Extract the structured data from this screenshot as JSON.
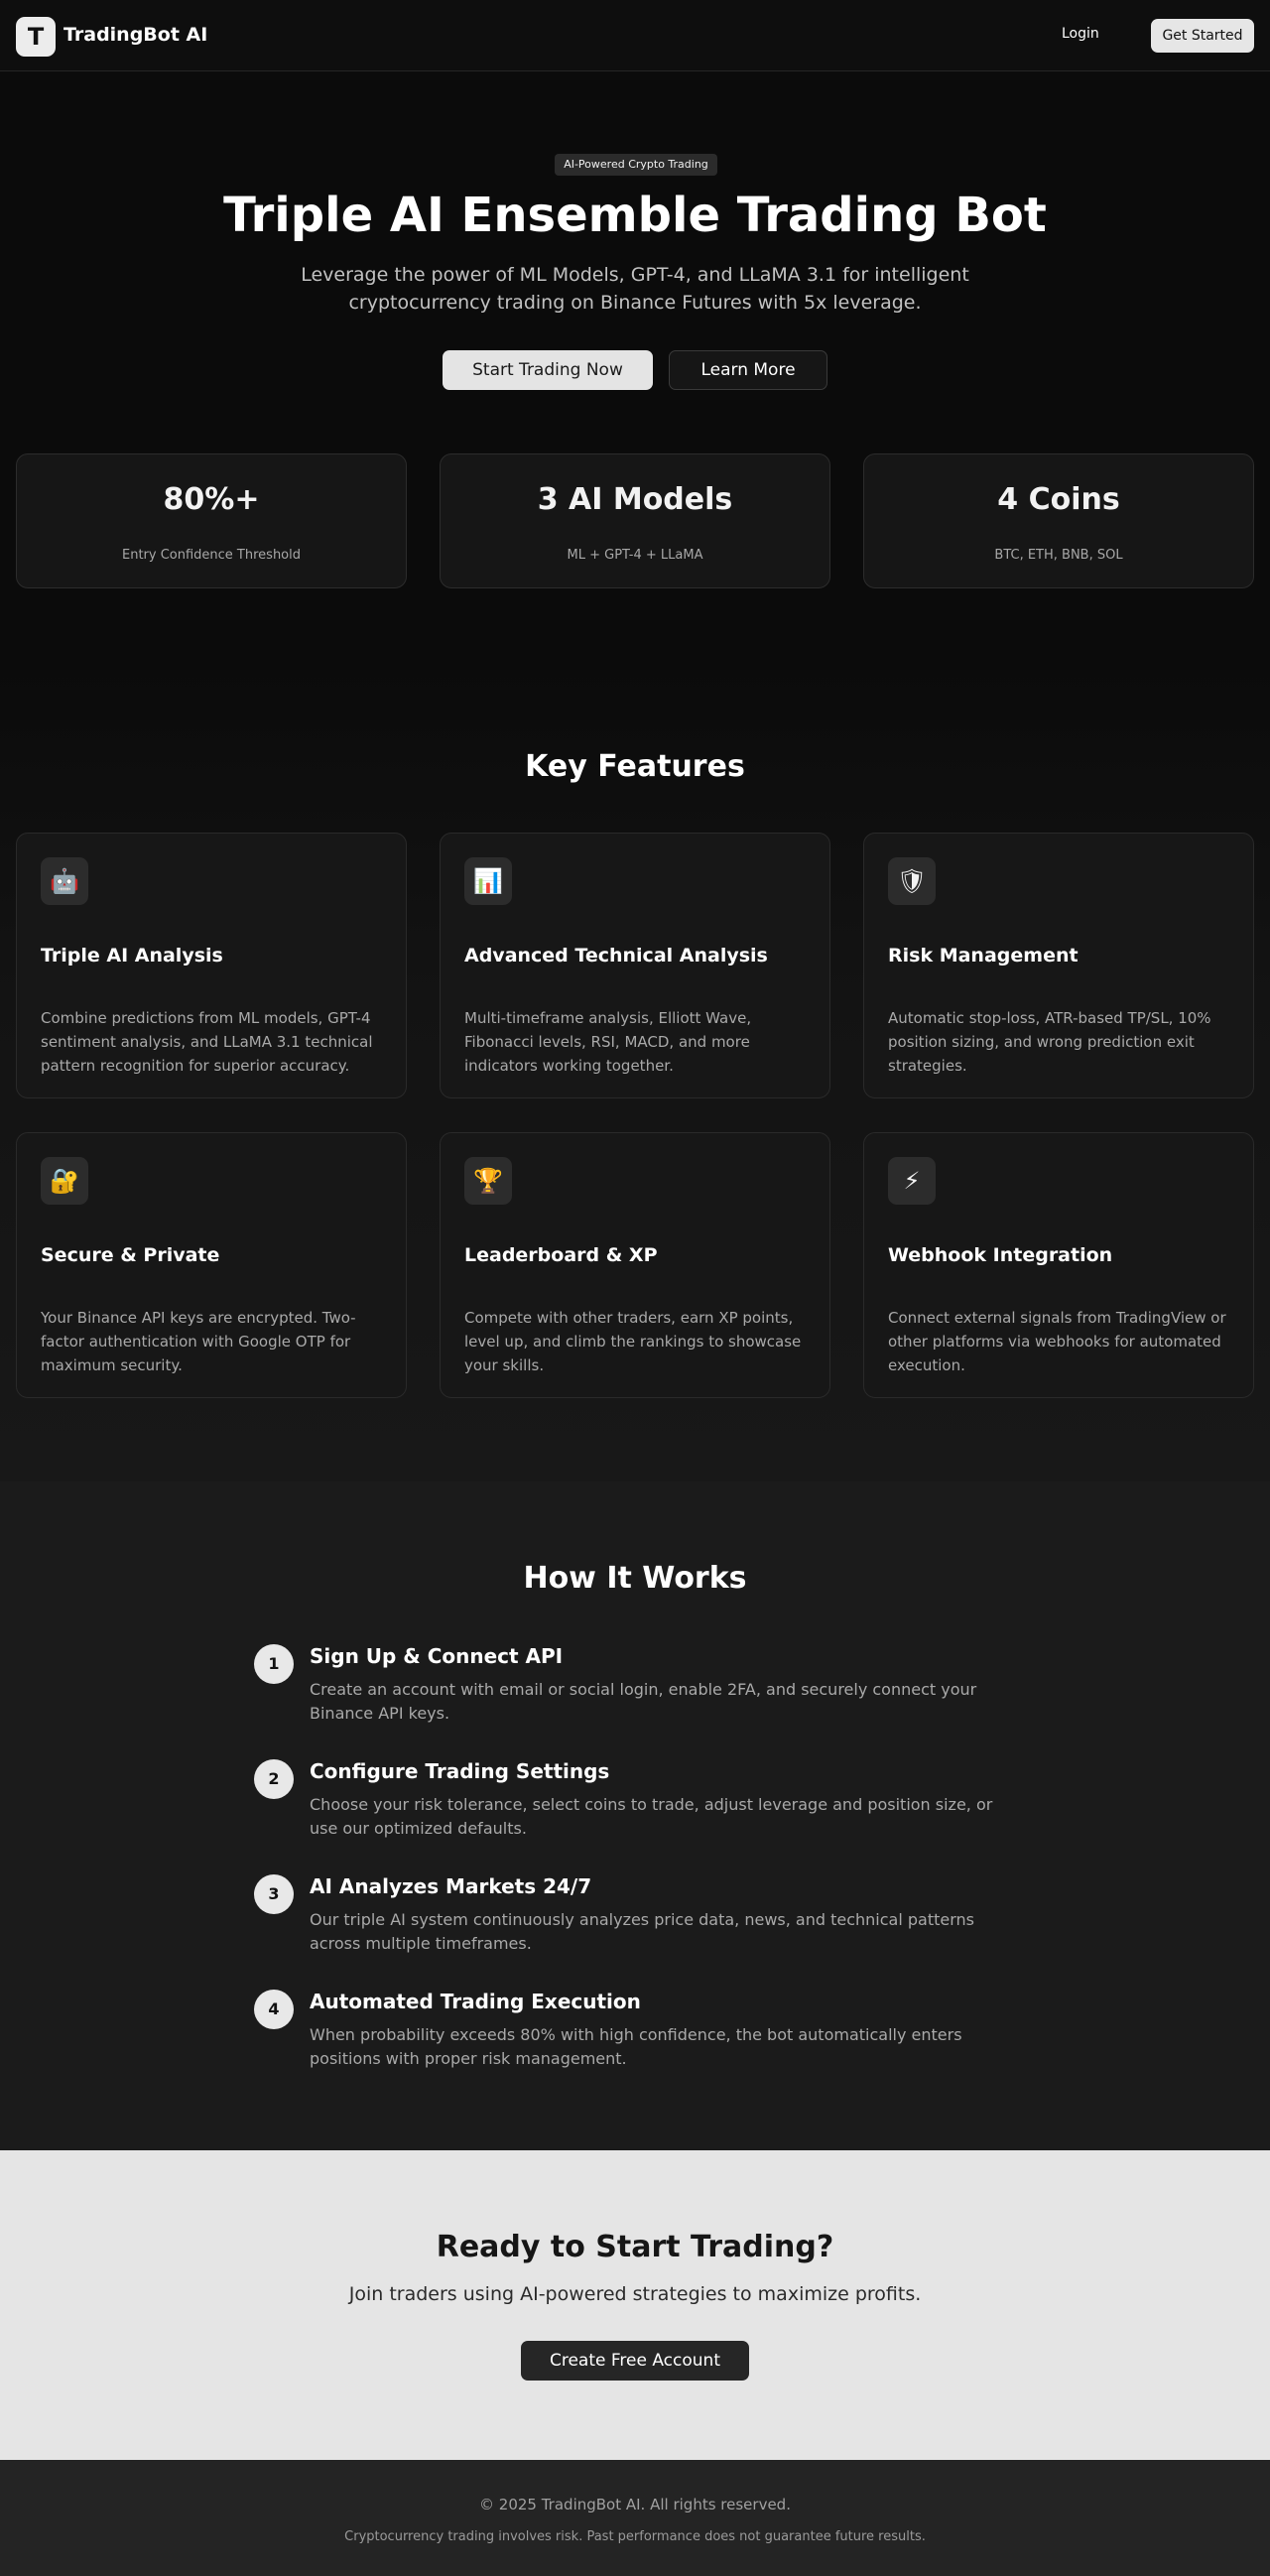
{
  "nav": {
    "logo_letter": "T",
    "brand": "TradingBot AI",
    "login": "Login",
    "get_started": "Get Started"
  },
  "hero": {
    "badge": "AI-Powered Crypto Trading",
    "title": "Triple AI Ensemble Trading Bot",
    "subtitle": "Leverage the power of ML Models, GPT-4, and LLaMA 3.1 for intelligent cryptocurrency trading on Binance Futures with 5x leverage.",
    "primary_button": "Start Trading Now",
    "secondary_button": "Learn More"
  },
  "stats": [
    {
      "value": "80%+",
      "label": "Entry Confidence Threshold"
    },
    {
      "value": "3 AI Models",
      "label": "ML + GPT-4 + LLaMA"
    },
    {
      "value": "4 Coins",
      "label": "BTC, ETH, BNB, SOL"
    }
  ],
  "features": {
    "title": "Key Features",
    "items": [
      {
        "icon": "robot-icon",
        "glyph": "🤖",
        "title": "Triple AI Analysis",
        "desc": "Combine predictions from ML models, GPT-4 sentiment analysis, and LLaMA 3.1 technical pattern recognition for superior accuracy."
      },
      {
        "icon": "bar-chart-icon",
        "glyph": "📊",
        "title": "Advanced Technical Analysis",
        "desc": "Multi-timeframe analysis, Elliott Wave, Fibonacci levels, RSI, MACD, and more indicators working together."
      },
      {
        "icon": "shield-icon",
        "glyph": "🛡",
        "title": "Risk Management",
        "desc": "Automatic stop-loss, ATR-based TP/SL, 10% position sizing, and wrong prediction exit strategies."
      },
      {
        "icon": "lock-icon",
        "glyph": "🔐",
        "title": "Secure & Private",
        "desc": "Your Binance API keys are encrypted. Two-factor authentication with Google OTP for maximum security."
      },
      {
        "icon": "trophy-icon",
        "glyph": "🏆",
        "title": "Leaderboard & XP",
        "desc": "Compete with other traders, earn XP points, level up, and climb the rankings to showcase your skills."
      },
      {
        "icon": "lightning-icon",
        "glyph": "⚡",
        "title": "Webhook Integration",
        "desc": "Connect external signals from TradingView or other platforms via webhooks for automated execution."
      }
    ]
  },
  "how": {
    "title": "How It Works",
    "steps": [
      {
        "num": "1",
        "title": "Sign Up & Connect API",
        "desc": "Create an account with email or social login, enable 2FA, and securely connect your Binance API keys."
      },
      {
        "num": "2",
        "title": "Configure Trading Settings",
        "desc": "Choose your risk tolerance, select coins to trade, adjust leverage and position size, or use our optimized defaults."
      },
      {
        "num": "3",
        "title": "AI Analyzes Markets 24/7",
        "desc": "Our triple AI system continuously analyzes price data, news, and technical patterns across multiple timeframes."
      },
      {
        "num": "4",
        "title": "Automated Trading Execution",
        "desc": "When probability exceeds 80% with high confidence, the bot automatically enters positions with proper risk management."
      }
    ]
  },
  "cta": {
    "title": "Ready to Start Trading?",
    "subtitle": "Join traders using AI-powered strategies to maximize profits.",
    "button": "Create Free Account"
  },
  "footer": {
    "copyright": "© 2025 TradingBot AI. All rights reserved.",
    "disclaimer": "Cryptocurrency trading involves risk. Past performance does not guarantee future results."
  }
}
